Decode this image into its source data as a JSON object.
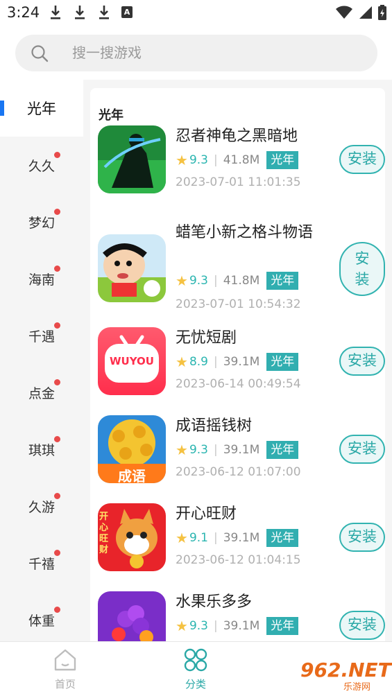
{
  "status_bar": {
    "time": "3:24",
    "notif_letter": "A"
  },
  "search": {
    "placeholder": "搜一搜游戏"
  },
  "sidebar": {
    "items": [
      {
        "label": "光年"
      },
      {
        "label": "久久"
      },
      {
        "label": "梦幻"
      },
      {
        "label": "海南"
      },
      {
        "label": "千遇"
      },
      {
        "label": "点金"
      },
      {
        "label": "琪琪"
      },
      {
        "label": "久游"
      },
      {
        "label": "千禧"
      },
      {
        "label": "体重"
      }
    ]
  },
  "main": {
    "section_title": "光年",
    "apps": [
      {
        "name": "忍者神龟之黑暗地",
        "rating": "9.3",
        "size": "41.8M",
        "tag": "光年",
        "date": "2023-07-01 11:01:35",
        "install": "安装",
        "icon": "ninja-turtle-game-icon"
      },
      {
        "name": "蜡笔小新之格斗物语",
        "rating": "9.3",
        "size": "41.8M",
        "tag": "光年",
        "date": "2023-07-01 10:54:32",
        "install": "安装",
        "icon": "crayon-shinchan-game-icon"
      },
      {
        "name": "无忧短剧",
        "rating": "8.9",
        "size": "39.1M",
        "tag": "光年",
        "date": "2023-06-14 00:49:54",
        "install": "安装",
        "icon": "wuyou-app-icon",
        "icon_text": "WUYOU"
      },
      {
        "name": "成语摇钱树",
        "rating": "9.3",
        "size": "39.1M",
        "tag": "光年",
        "date": "2023-06-12 01:07:00",
        "install": "安装",
        "icon": "money-tree-game-icon",
        "icon_text": "成语"
      },
      {
        "name": "开心旺财",
        "rating": "9.1",
        "size": "39.1M",
        "tag": "光年",
        "date": "2023-06-12 01:04:15",
        "install": "安装",
        "icon": "happy-dog-game-icon",
        "icon_text": "开心旺财"
      },
      {
        "name": "水果乐多多",
        "rating": "9.3",
        "size": "39.1M",
        "tag": "光年",
        "date": "",
        "install": "安装",
        "icon": "fruit-game-icon"
      }
    ]
  },
  "bottom_nav": {
    "items": [
      {
        "label": "首页",
        "icon": "home-icon"
      },
      {
        "label": "分类",
        "icon": "category-icon"
      }
    ]
  },
  "watermark": {
    "text": "962.NET",
    "sub": "乐游网"
  },
  "colors": {
    "accent": "#31aeb0",
    "active_bar": "#1976f2",
    "dot": "#e84a4a",
    "star": "#f5c242"
  }
}
